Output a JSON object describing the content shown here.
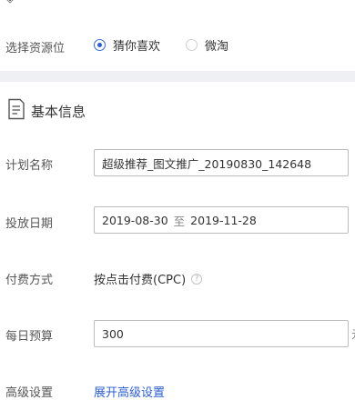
{
  "resource_row": {
    "label": "选择资源位",
    "options": [
      {
        "label": "猜你喜欢",
        "selected": true
      },
      {
        "label": "微淘",
        "selected": false
      }
    ]
  },
  "section": {
    "title": "基本信息",
    "icon": "document-icon"
  },
  "plan_name": {
    "label": "计划名称",
    "value": "超级推荐_图文推广_20190830_142648"
  },
  "schedule": {
    "label": "投放日期",
    "start": "2019-08-30",
    "separator": "至",
    "end": "2019-11-28"
  },
  "billing": {
    "label": "付费方式",
    "value": "按点击付费(CPC)",
    "help_icon": "question-icon"
  },
  "daily_budget": {
    "label": "每日预算",
    "value": "300"
  },
  "advanced": {
    "label": "高级设置",
    "link": "展开高级设置"
  },
  "accent_color": "#2f5fd0"
}
